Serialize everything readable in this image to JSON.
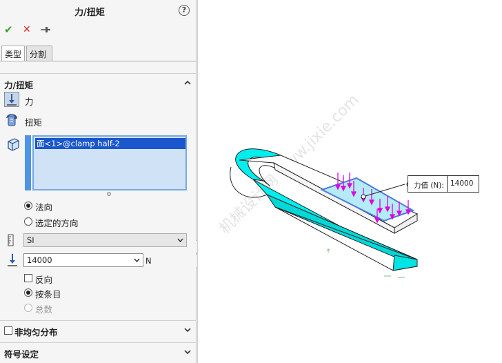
{
  "panel": {
    "title": "力/扭矩",
    "help_icon": "?",
    "actions": {
      "ok_icon": "✔",
      "cancel_icon": "✕",
      "pin_icon": "⊣"
    },
    "tabs": [
      {
        "label": "类型"
      },
      {
        "label": "分割"
      }
    ],
    "force_torque_section": {
      "title": "力/扭矩",
      "force_label": "力",
      "torque_label": "扭矩",
      "selection_item": "面<1>@clamp half-2",
      "direction_options": [
        {
          "label": "法向",
          "selected": true
        },
        {
          "label": "选定的方向",
          "selected": false
        }
      ],
      "units_value": "SI",
      "force_value": "14000",
      "force_unit": "N",
      "reverse_label": "反向",
      "reverse_checked": false,
      "distribution_options": [
        {
          "label": "按条目",
          "selected": true,
          "enabled": true
        },
        {
          "label": "总数",
          "selected": false,
          "enabled": false
        }
      ]
    },
    "nonuniform_section": {
      "title": "非均匀分布",
      "checked": false
    },
    "symbol_section": {
      "title": "符号设定"
    }
  },
  "viewport": {
    "callout_label": "力值 (N):",
    "callout_value": "14000",
    "watermark": "机械设计网 www.jixie.com",
    "colors": {
      "highlight": "#00f0f0",
      "arrow": "#e000e0",
      "face": "#b3ecf7",
      "face_edge": "#4d7ae0"
    }
  }
}
